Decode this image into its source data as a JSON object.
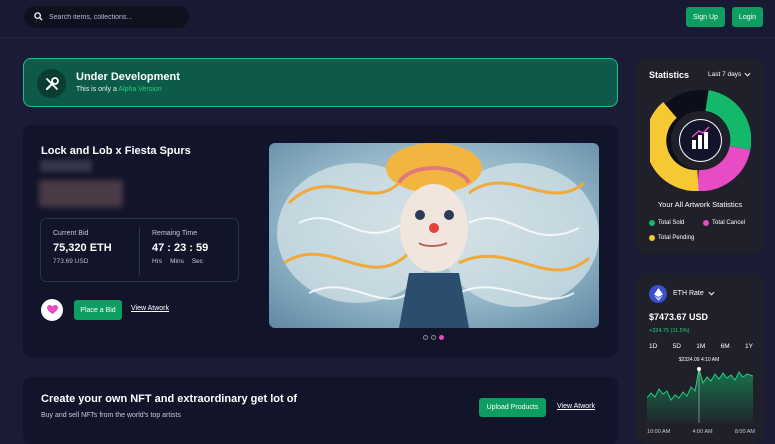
{
  "topbar": {
    "search_placeholder": "Search items, collections...",
    "signup_label": "Sign Up",
    "login_label": "Login"
  },
  "banner": {
    "title": "Under Development",
    "subtitle_prefix": "This is only a ",
    "subtitle_highlight": "Alpha Version"
  },
  "hero": {
    "title": "Lock and Lob x Fiesta Spurs",
    "current_bid_label": "Current Bid",
    "current_bid_value": "75,320 ETH",
    "current_bid_usd": "773.69 USD",
    "remaining_label": "Remaing Time",
    "remaining_value": "47 : 23 : 59",
    "time_units": [
      "Hrs",
      "Mins",
      "Sec"
    ],
    "place_bid_label": "Place a Bid",
    "view_artwork_label": "View Atwork",
    "carousel_active_index": 2,
    "carousel_count": 3
  },
  "promo": {
    "title": "Create your own NFT and extraordinary get lot of",
    "subtitle": "Buy and sell NFTs from the world's top artists",
    "upload_label": "Upload Products",
    "view_label": "View Atwork"
  },
  "stats": {
    "title": "Statistics",
    "period": "Last 7 days",
    "caption": "Your All Artwork Statistics",
    "legend": [
      {
        "label": "Total Sold",
        "color": "#14b86b"
      },
      {
        "label": "Total Cancel",
        "color": "#e84bc4"
      },
      {
        "label": "Total Pending",
        "color": "#f6c934"
      }
    ]
  },
  "eth_rate": {
    "label": "ETH Rate",
    "price": "$7473.67 USD",
    "change": "+324.75 (11.5%)",
    "ranges": [
      "1D",
      "5D",
      "1M",
      "6M",
      "1Y"
    ],
    "tooltip_value": "$2324.09",
    "tooltip_time": "4:10 AM",
    "times": [
      "10:00 AM",
      "4:00 AM",
      "8:00 AM"
    ]
  },
  "colors": {
    "accent_green": "#0e9e61",
    "banner_bg": "#0d5a4a",
    "pink": "#e84bc4",
    "yellow": "#f6c934"
  }
}
